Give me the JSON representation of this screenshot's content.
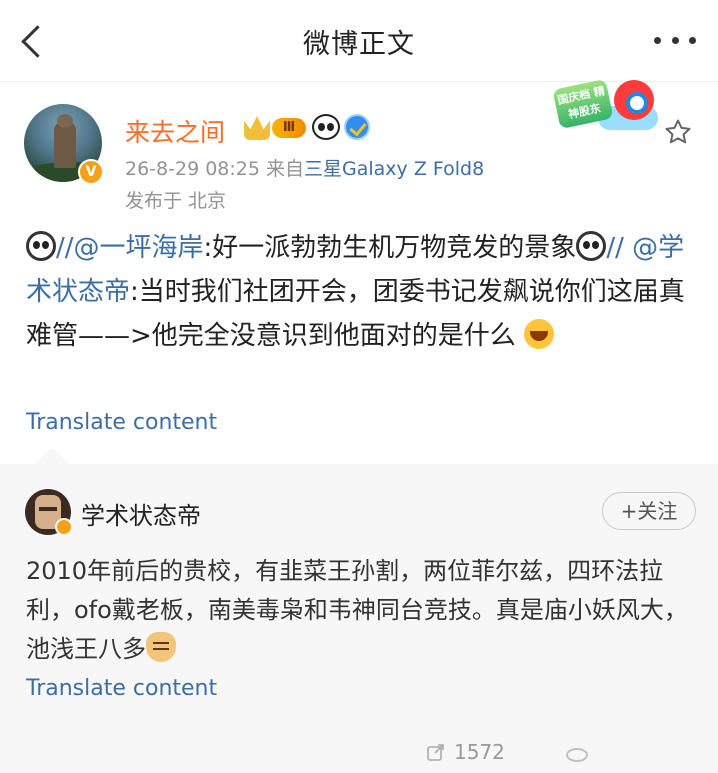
{
  "header": {
    "title": "微博正文"
  },
  "post": {
    "username": "来去之间",
    "level": "Ⅲ",
    "time": "26-8-29 08:25",
    "source_prefix": "来自",
    "source_device": "三星Galaxy Z Fold8",
    "location": "发布于 北京",
    "sticker_text": "国庆档 精神股东",
    "text_part1": "//",
    "mention1": "@一坪海岸",
    "text_part2": ":好一派勃勃生机万物竞发的景象",
    "text_part3": "//",
    "mention2": "@学术状态帝",
    "text_part4": ":当时我们社团开会，团委书记发飙说你们这届真难管——>他完全没意识到他面对的是什么",
    "translate_label": "Translate content"
  },
  "retweet": {
    "username": "学术状态帝",
    "follow_label": "+关注",
    "text": "2010年前后的贵校，有韭菜王孙割，两位菲尔兹，四环法拉利，ofo戴老板，南美毒枭和韦神同台竞技。真是庙小妖风大，池浅王八多",
    "translate_label": "Translate content",
    "repost_count": "1572"
  },
  "colors": {
    "username_orange": "#f86c25",
    "link_blue": "#3c6ea5",
    "meta_gray": "#939393",
    "retweet_bg": "#f7f7f7"
  },
  "icons": [
    "back-arrow-icon",
    "more-dots-icon",
    "star-icon",
    "panda-icon",
    "verify-icon",
    "crown-icon",
    "repost-icon",
    "laugh-emoji-icon",
    "doge-emoji-icon"
  ]
}
